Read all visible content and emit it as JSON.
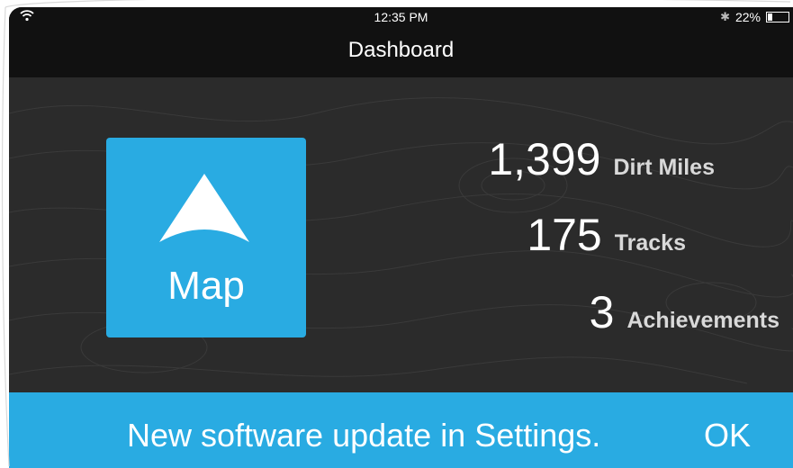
{
  "status_bar": {
    "time": "12:35 PM",
    "battery_percent_text": "22%",
    "battery_level": 0.22,
    "icons": [
      "wifi-icon",
      "bluetooth-icon",
      "battery-icon"
    ]
  },
  "nav": {
    "title": "Dashboard"
  },
  "map_button": {
    "label": "Map",
    "icon": "navigation-arrow-icon"
  },
  "stats": [
    {
      "value": "1,399",
      "label": "Dirt Miles"
    },
    {
      "value": "175",
      "label": "Tracks"
    },
    {
      "value": "3",
      "label": "Achievements"
    }
  ],
  "banner": {
    "message": "New software update in Settings.",
    "action": "OK"
  },
  "colors": {
    "accent": "#29abe2",
    "background": "#2b2b2b",
    "bar": "#111111"
  }
}
